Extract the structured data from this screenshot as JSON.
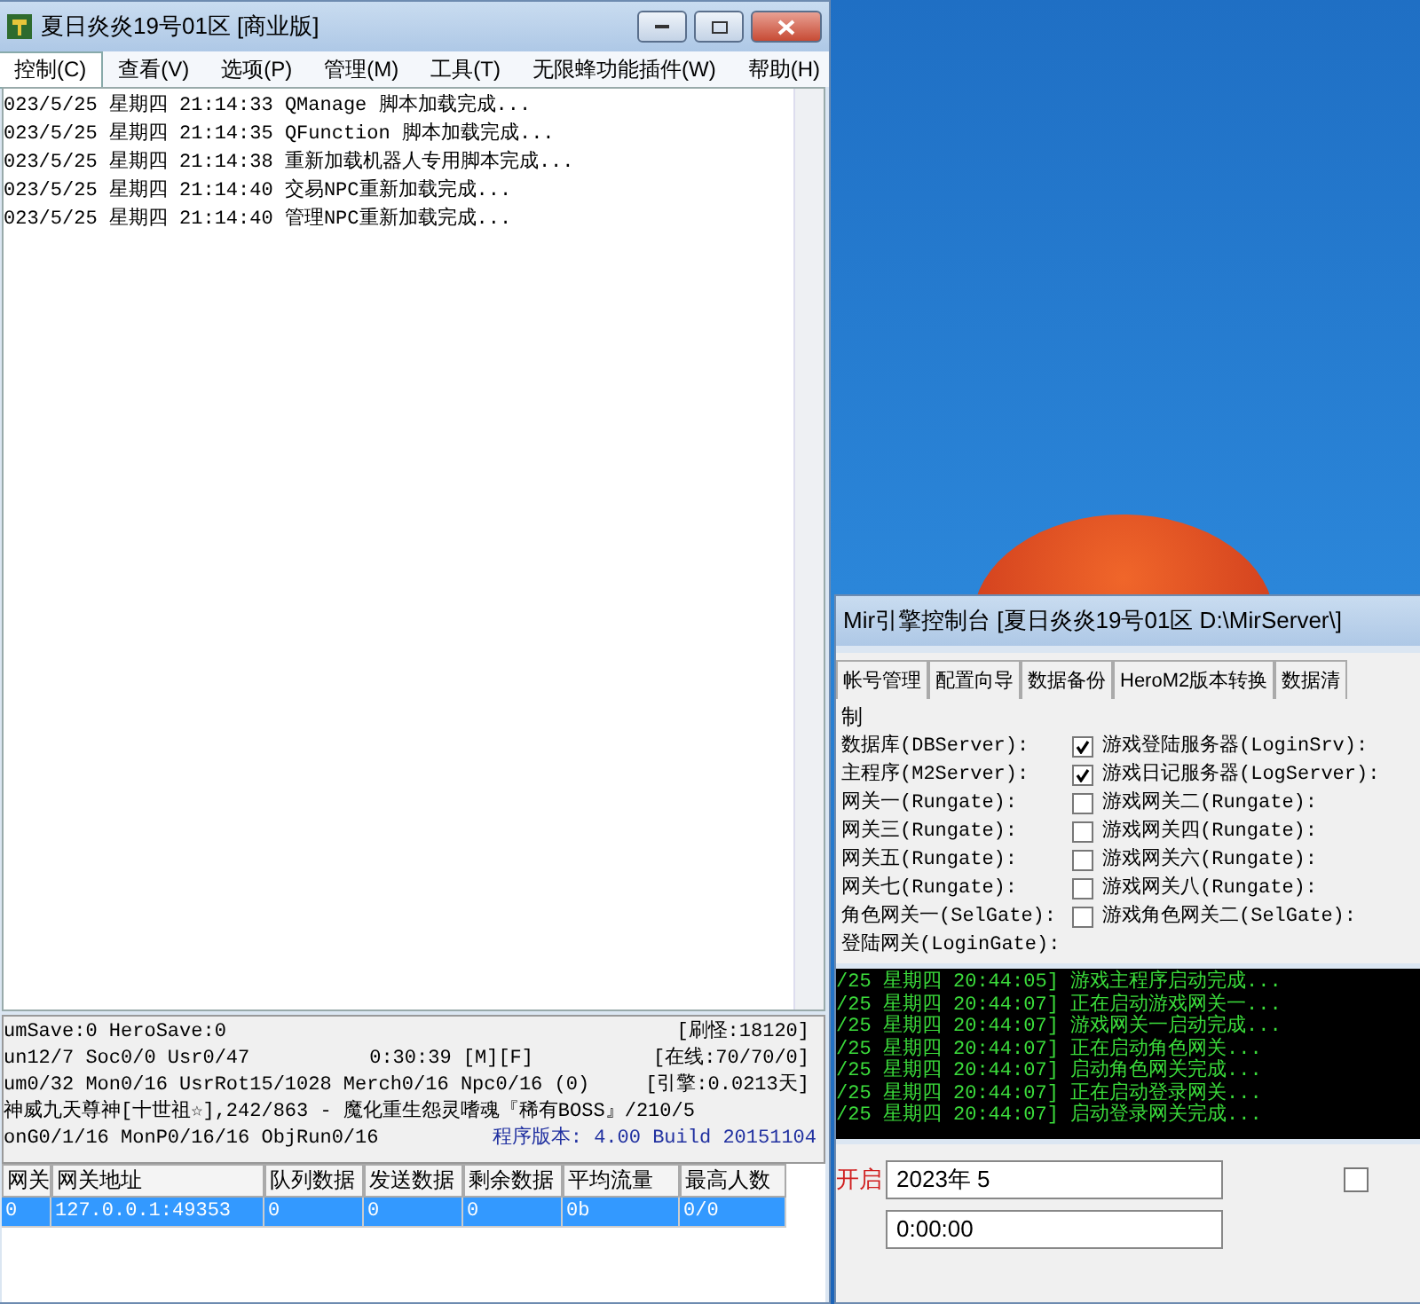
{
  "main_window": {
    "title": "夏日炎炎19号01区 [商业版]",
    "menu": [
      {
        "label": "控制(C)",
        "selected": true
      },
      {
        "label": "查看(V)",
        "selected": false
      },
      {
        "label": "选项(P)",
        "selected": false
      },
      {
        "label": "管理(M)",
        "selected": false
      },
      {
        "label": "工具(T)",
        "selected": false
      },
      {
        "label": "无限蜂功能插件(W)",
        "selected": false
      },
      {
        "label": "帮助(H)",
        "selected": false
      }
    ],
    "log": [
      {
        "date": "023/5/25",
        "weekday": "星期四",
        "time": "21:14:33",
        "message": "QManage 脚本加载完成..."
      },
      {
        "date": "023/5/25",
        "weekday": "星期四",
        "time": "21:14:35",
        "message": "QFunction 脚本加载完成..."
      },
      {
        "date": "023/5/25",
        "weekday": "星期四",
        "time": "21:14:38",
        "message": "重新加载机器人专用脚本完成..."
      },
      {
        "date": "023/5/25",
        "weekday": "星期四",
        "time": "21:14:40",
        "message": "交易NPC重新加载完成..."
      },
      {
        "date": "023/5/25",
        "weekday": "星期四",
        "time": "21:14:40",
        "message": "管理NPC重新加载完成..."
      }
    ],
    "status": {
      "line_1": "umSave:0 HeroSave:0",
      "line_2": "un12/7 Soc0/0 Usr0/47",
      "clock": "0:30:39 [M][F]",
      "line_3": "um0/32 Mon0/16 UsrRot15/1028 Merch0/16 Npc0/16 (0)",
      "line_4": "神威九天尊神[十世祖☆],242/863 - 魔化重生怨灵嗜魂『稀有BOSS』/210/5",
      "line_5": "onG0/1/16 MonP0/16/16 ObjRun0/16",
      "right": [
        "[刷怪:18120]",
        "[在线:70/70/0]",
        "[引擎:0.0213天]"
      ],
      "version": "程序版本: 4.00 Build 20151104"
    },
    "table": {
      "columns": [
        "网关",
        "网关地址",
        "队列数据",
        "发送数据",
        "剩余数据",
        "平均流量",
        "最高人数"
      ],
      "rows": [
        {
          "cells": [
            "0",
            "127.0.0.1:49353",
            "0",
            "0",
            "0",
            "0b",
            "0/0"
          ],
          "selected": true
        }
      ]
    }
  },
  "console_window": {
    "title": "Mir引擎控制台 [夏日炎炎19号01区 D:\\MirServer\\]",
    "tabs": [
      {
        "label": "帐号管理",
        "selected": false
      },
      {
        "label": "配置向导",
        "selected": false
      },
      {
        "label": "数据备份",
        "selected": false
      },
      {
        "label": "HeroM2版本转换",
        "selected": false
      },
      {
        "label": "数据清",
        "selected": false
      }
    ],
    "group_title": "制",
    "left_items": [
      "数据库(DBServer):",
      "主程序(M2Server):",
      "网关一(Rungate):",
      "网关三(Rungate):",
      "网关五(Rungate):",
      "网关七(Rungate):",
      "角色网关一(SelGate):",
      "登陆网关(LoginGate):"
    ],
    "right_items": [
      {
        "label": "游戏登陆服务器(LoginSrv):",
        "checked": true
      },
      {
        "label": "游戏日记服务器(LogServer):",
        "checked": true
      },
      {
        "label": "游戏网关二(Rungate):",
        "checked": false
      },
      {
        "label": "游戏网关四(Rungate):",
        "checked": false
      },
      {
        "label": "游戏网关六(Rungate):",
        "checked": false
      },
      {
        "label": "游戏网关八(Rungate):",
        "checked": false
      },
      {
        "label": "游戏角色网关二(SelGate):",
        "checked": false
      }
    ],
    "log": [
      "/25 星期四 20:44:05] 游戏主程序启动完成...",
      "/25 星期四 20:44:07] 正在启动游戏网关一...",
      "/25 星期四 20:44:07] 游戏网关一启动完成...",
      "/25 星期四 20:44:07] 正在启动角色网关...",
      "/25 星期四 20:44:07] 启动角色网关完成...",
      "/25 星期四 20:44:07] 正在启动登录网关...",
      "/25 星期四 20:44:07] 启动登录网关完成..."
    ],
    "start_label": "开启",
    "date_value": "2023年 5",
    "time_value": "0:00:00",
    "side_checkbox": {
      "checked": false
    }
  }
}
